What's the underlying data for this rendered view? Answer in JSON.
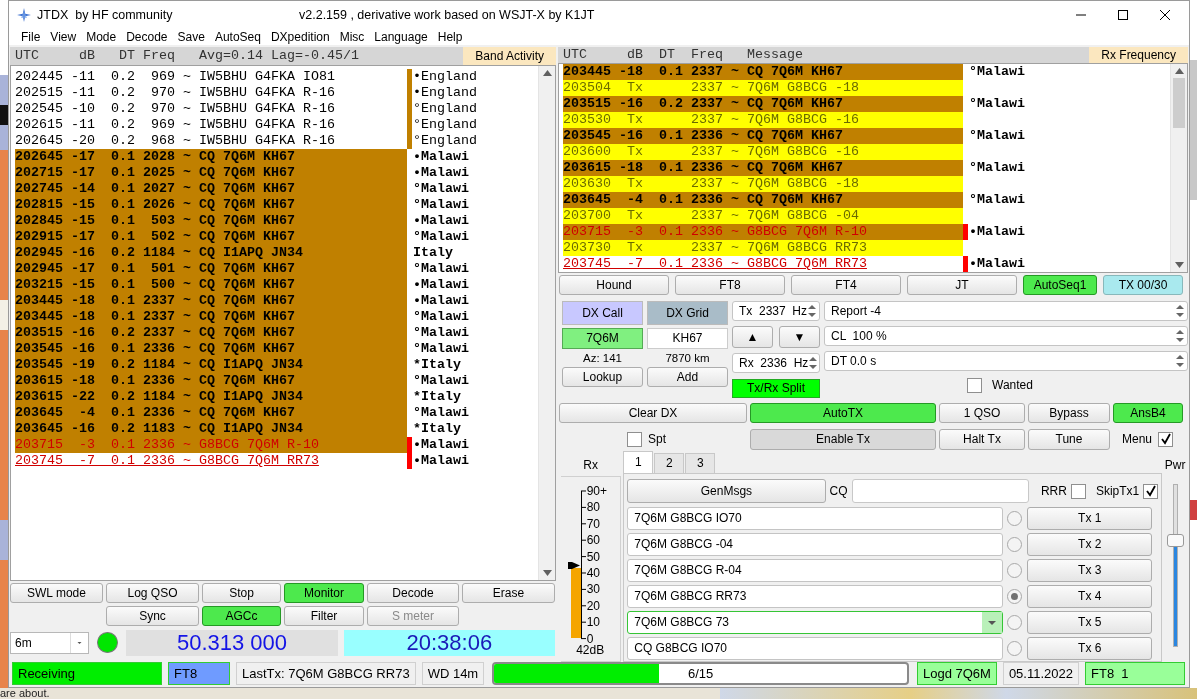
{
  "window": {
    "title": "JTDX  by HF community",
    "subtitle": "v2.2.159 , derivative work based on WSJT-X by K1JT"
  },
  "menu": [
    "File",
    "View",
    "Mode",
    "Decode",
    "Save",
    "AutoSeq",
    "DXpedition",
    "Misc",
    "Language",
    "Help"
  ],
  "band_activity": {
    "header": "UTC     dB   DT Freq   Avg=0.14 Lag=-0.45/1",
    "label": "Band Activity",
    "rows": [
      {
        "line": "202445 -11  0.2  969 ~ IW5BHU G4FKA IO81",
        "country": "•England",
        "kind": "plain",
        "to_me": false,
        "underlined": false,
        "color": "#c08000"
      },
      {
        "line": "202515 -11  0.2  970 ~ IW5BHU G4FKA R-16",
        "country": "•England",
        "kind": "plain",
        "to_me": false,
        "underlined": false,
        "color": "#c08000"
      },
      {
        "line": "202545 -10  0.2  970 ~ IW5BHU G4FKA R-16",
        "country": "°England",
        "kind": "plain",
        "to_me": false,
        "underlined": false,
        "color": "#c08000"
      },
      {
        "line": "202615 -11  0.2  969 ~ IW5BHU G4FKA R-16",
        "country": "°England",
        "kind": "plain",
        "to_me": false,
        "underlined": false,
        "color": "#c08000"
      },
      {
        "line": "202645 -20  0.2  968 ~ IW5BHU G4FKA R-16",
        "country": "°England",
        "kind": "plain",
        "to_me": false,
        "underlined": false,
        "color": "#c08000"
      },
      {
        "line": "202645 -17  0.1 2028 ~ CQ 7Q6M KH67",
        "country": "•Malawi",
        "kind": "cq",
        "to_me": false,
        "underlined": false
      },
      {
        "line": "202715 -17  0.1 2025 ~ CQ 7Q6M KH67",
        "country": "•Malawi",
        "kind": "cq",
        "to_me": false,
        "underlined": false
      },
      {
        "line": "202745 -14  0.1 2027 ~ CQ 7Q6M KH67",
        "country": "°Malawi",
        "kind": "cq",
        "to_me": false,
        "underlined": false
      },
      {
        "line": "202815 -15  0.1 2026 ~ CQ 7Q6M KH67",
        "country": "°Malawi",
        "kind": "cq",
        "to_me": false,
        "underlined": false
      },
      {
        "line": "202845 -15  0.1  503 ~ CQ 7Q6M KH67",
        "country": "•Malawi",
        "kind": "cq",
        "to_me": false,
        "underlined": false
      },
      {
        "line": "202915 -17  0.1  502 ~ CQ 7Q6M KH67",
        "country": "°Malawi",
        "kind": "cq",
        "to_me": false,
        "underlined": false
      },
      {
        "line": "202945 -16  0.2 1184 ~ CQ I1APQ JN34",
        "country": "Italy",
        "kind": "cq",
        "to_me": false,
        "underlined": false
      },
      {
        "line": "202945 -17  0.1  501 ~ CQ 7Q6M KH67",
        "country": "°Malawi",
        "kind": "cq",
        "to_me": false,
        "underlined": false
      },
      {
        "line": "203215 -15  0.1  500 ~ CQ 7Q6M KH67",
        "country": "•Malawi",
        "kind": "cq",
        "to_me": false,
        "underlined": false
      },
      {
        "line": "203445 -18  0.1 2337 ~ CQ 7Q6M KH67",
        "country": "•Malawi",
        "kind": "cq",
        "to_me": false,
        "underlined": false
      },
      {
        "line": "203445 -18  0.1 2337 ~ CQ 7Q6M KH67",
        "country": "°Malawi",
        "kind": "cq",
        "to_me": false,
        "underlined": false
      },
      {
        "line": "203515 -16  0.2 2337 ~ CQ 7Q6M KH67",
        "country": "°Malawi",
        "kind": "cq",
        "to_me": false,
        "underlined": false
      },
      {
        "line": "203545 -16  0.1 2336 ~ CQ 7Q6M KH67",
        "country": "°Malawi",
        "kind": "cq",
        "to_me": false,
        "underlined": false
      },
      {
        "line": "203545 -19  0.2 1184 ~ CQ I1APQ JN34",
        "country": "*Italy",
        "kind": "cq",
        "to_me": false,
        "underlined": false
      },
      {
        "line": "203615 -18  0.1 2336 ~ CQ 7Q6M KH67",
        "country": "°Malawi",
        "kind": "cq",
        "to_me": false,
        "underlined": false
      },
      {
        "line": "203615 -22  0.2 1184 ~ CQ I1APQ JN34",
        "country": "*Italy",
        "kind": "cq",
        "to_me": false,
        "underlined": false
      },
      {
        "line": "203645  -4  0.1 2336 ~ CQ 7Q6M KH67",
        "country": "°Malawi",
        "kind": "cq",
        "to_me": false,
        "underlined": false
      },
      {
        "line": "203645 -16  0.2 1183 ~ CQ I1APQ JN34",
        "country": "*Italy",
        "kind": "cq",
        "to_me": false,
        "underlined": false
      },
      {
        "line": "203715  -3  0.1 2336 ~ G8BCG 7Q6M R-10",
        "country": "•Malawi",
        "kind": "cq",
        "to_me": true,
        "underlined": false,
        "color": "#ff0000"
      },
      {
        "line": "203745  -7  0.1 2336 ~ G8BCG 7Q6M RR73",
        "country": "•Malawi",
        "kind": "plain",
        "to_me": true,
        "underlined": true,
        "color": "#ff0000"
      }
    ]
  },
  "rx_frequency": {
    "header": "UTC     dB  DT  Freq   Message",
    "label": "Rx Frequency",
    "rows": [
      {
        "line": "203445 -18  0.1 2337 ~ CQ 7Q6M KH67",
        "country": "°Malawi",
        "kind": "cq",
        "to_me": false,
        "underlined": false
      },
      {
        "line": "203504  Tx      2337 ~ 7Q6M G8BCG -18",
        "kind": "tx",
        "to_me": false,
        "underlined": false
      },
      {
        "line": "203515 -16  0.2 2337 ~ CQ 7Q6M KH67",
        "country": "°Malawi",
        "kind": "cq",
        "to_me": false,
        "underlined": false
      },
      {
        "line": "203530  Tx      2337 ~ 7Q6M G8BCG -16",
        "kind": "tx",
        "to_me": false,
        "underlined": false
      },
      {
        "line": "203545 -16  0.1 2336 ~ CQ 7Q6M KH67",
        "country": "°Malawi",
        "kind": "cq",
        "to_me": false,
        "underlined": false
      },
      {
        "line": "203600  Tx      2337 ~ 7Q6M G8BCG -16",
        "kind": "tx",
        "to_me": false,
        "underlined": false
      },
      {
        "line": "203615 -18  0.1 2336 ~ CQ 7Q6M KH67",
        "country": "°Malawi",
        "kind": "cq",
        "to_me": false,
        "underlined": false
      },
      {
        "line": "203630  Tx      2337 ~ 7Q6M G8BCG -18",
        "kind": "tx",
        "to_me": false,
        "underlined": false
      },
      {
        "line": "203645  -4  0.1 2336 ~ CQ 7Q6M KH67",
        "country": "°Malawi",
        "kind": "cq",
        "to_me": false,
        "underlined": false
      },
      {
        "line": "203700  Tx      2337 ~ 7Q6M G8BCG -04",
        "kind": "tx",
        "to_me": false,
        "underlined": false
      },
      {
        "line": "203715  -3  0.1 2336 ~ G8BCG 7Q6M R-10",
        "country": "•Malawi",
        "kind": "cq",
        "to_me": true,
        "underlined": false,
        "color": "#ff0000"
      },
      {
        "line": "203730  Tx      2337 ~ 7Q6M G8BCG RR73",
        "kind": "tx",
        "to_me": false,
        "underlined": false
      },
      {
        "line": "203745  -7  0.1 2336 ~ G8BCG 7Q6M RR73",
        "country": "•Malawi",
        "kind": "plain",
        "to_me": true,
        "underlined": true,
        "color": "#ff0000"
      }
    ]
  },
  "bottom_buttons": [
    [
      {
        "label": "SWL mode",
        "on": false,
        "disabled": false
      },
      {
        "label": "Log QSO",
        "on": false,
        "disabled": false
      },
      {
        "label": "Stop",
        "on": false,
        "disabled": false
      },
      {
        "label": "Monitor",
        "on": true,
        "disabled": false
      },
      {
        "label": "Decode",
        "on": false,
        "disabled": false
      },
      {
        "label": "Erase",
        "on": false,
        "disabled": false
      }
    ],
    [
      {
        "label": "Sync",
        "on": false,
        "disabled": false
      },
      {
        "label": "AGCc",
        "on": true,
        "disabled": false
      },
      {
        "label": "Filter",
        "on": false,
        "disabled": false
      },
      {
        "label": "S meter",
        "on": false,
        "disabled": true
      }
    ]
  ],
  "band": "6m",
  "rig_connected": true,
  "dial_frequency": "50.313 000",
  "clock": "20:38:06",
  "mode_buttons": [
    {
      "label": "Hound",
      "kind": "toggle",
      "on": false
    },
    {
      "label": "FT8",
      "kind": "toggle",
      "on": false
    },
    {
      "label": "FT4",
      "kind": "toggle",
      "on": false
    },
    {
      "label": "JT",
      "kind": "toggle",
      "on": false
    },
    {
      "label": "AutoSeq1",
      "kind": "toggle",
      "on": true
    },
    {
      "label": "TX 00/30",
      "kind": "indicator",
      "on": false
    }
  ],
  "dx": {
    "call_label": "DX Call",
    "grid_label": "DX Grid",
    "call": "7Q6M",
    "grid": "KH67",
    "azimuth": "Az: 141",
    "distance": "7870 km",
    "lookup": "Lookup",
    "add": "Add"
  },
  "tx_rx": {
    "tx": "Tx  2337  Hz",
    "up": "▲",
    "down": "▼",
    "rx": "Rx  2336  Hz",
    "split": {
      "label": "Tx/Rx Split",
      "on": true
    }
  },
  "report_fields": [
    "Report -4",
    "CL  100 %",
    "DT 0.0 s"
  ],
  "wanted": {
    "label": "Wanted",
    "checked": false
  },
  "qso_buttons": [
    {
      "label": "Clear DX",
      "on": false
    },
    {
      "label": "AutoTX",
      "on": true
    },
    {
      "label": "1 QSO",
      "on": false
    },
    {
      "label": "Bypass",
      "on": false
    },
    {
      "label": "AnsB4",
      "on": true
    }
  ],
  "spot": {
    "label": "Spt",
    "checked": false
  },
  "tx_buttons": [
    {
      "label": "Enable Tx",
      "kind": "latched"
    },
    {
      "label": "Halt Tx",
      "kind": "toggle"
    },
    {
      "label": "Tune",
      "kind": "toggle"
    }
  ],
  "menu_toggle": {
    "label": "Menu",
    "checked": true
  },
  "rx_meter": {
    "label": "Rx",
    "ticks": [
      "90+",
      "80",
      "70",
      "60",
      "50",
      "40",
      "30",
      "20",
      "10",
      "0"
    ],
    "level": 0.47,
    "reading": "42dB"
  },
  "tabs": [
    {
      "label": "1",
      "selected": true
    },
    {
      "label": "2",
      "selected": false
    },
    {
      "label": "3",
      "selected": false
    }
  ],
  "generator": {
    "button": "GenMsgs",
    "cq_label": "CQ",
    "rrr": {
      "label": "RRR",
      "checked": false
    },
    "skip_tx1": {
      "label": "SkipTx1",
      "checked": true
    }
  },
  "messages": [
    {
      "text": "7Q6M G8BCG IO70",
      "kind": "field",
      "selected": false,
      "button": "Tx 1"
    },
    {
      "text": "7Q6M G8BCG -04",
      "kind": "field",
      "selected": false,
      "button": "Tx 2"
    },
    {
      "text": "7Q6M G8BCG R-04",
      "kind": "field",
      "selected": false,
      "button": "Tx 3"
    },
    {
      "text": "7Q6M G8BCG RR73",
      "kind": "field",
      "selected": true,
      "button": "Tx 4"
    },
    {
      "text": "7Q6M G8BCG 73",
      "kind": "combo",
      "selected": false,
      "button": "Tx 5"
    },
    {
      "text": "CQ G8BCG IO70",
      "kind": "field",
      "selected": false,
      "button": "Tx 6"
    }
  ],
  "power": {
    "label": "Pwr",
    "level": 0.65
  },
  "status_bar": {
    "left": [
      {
        "text": "Receiving",
        "color": "#00ee00"
      },
      {
        "text": "FT8",
        "color": "#6f9bff"
      },
      {
        "text": "LastTx: 7Q6M G8BCG RR73"
      },
      {
        "text": "WD 14m"
      }
    ],
    "progress": {
      "text": "6/15",
      "level": 0.4
    },
    "right": [
      {
        "text": "Logd 7Q6M",
        "color": "#99ff99"
      },
      {
        "text": "05.11.2022"
      },
      {
        "text": "FT8  1",
        "color": "#99ff99"
      }
    ]
  },
  "background": {
    "text": "are about."
  }
}
